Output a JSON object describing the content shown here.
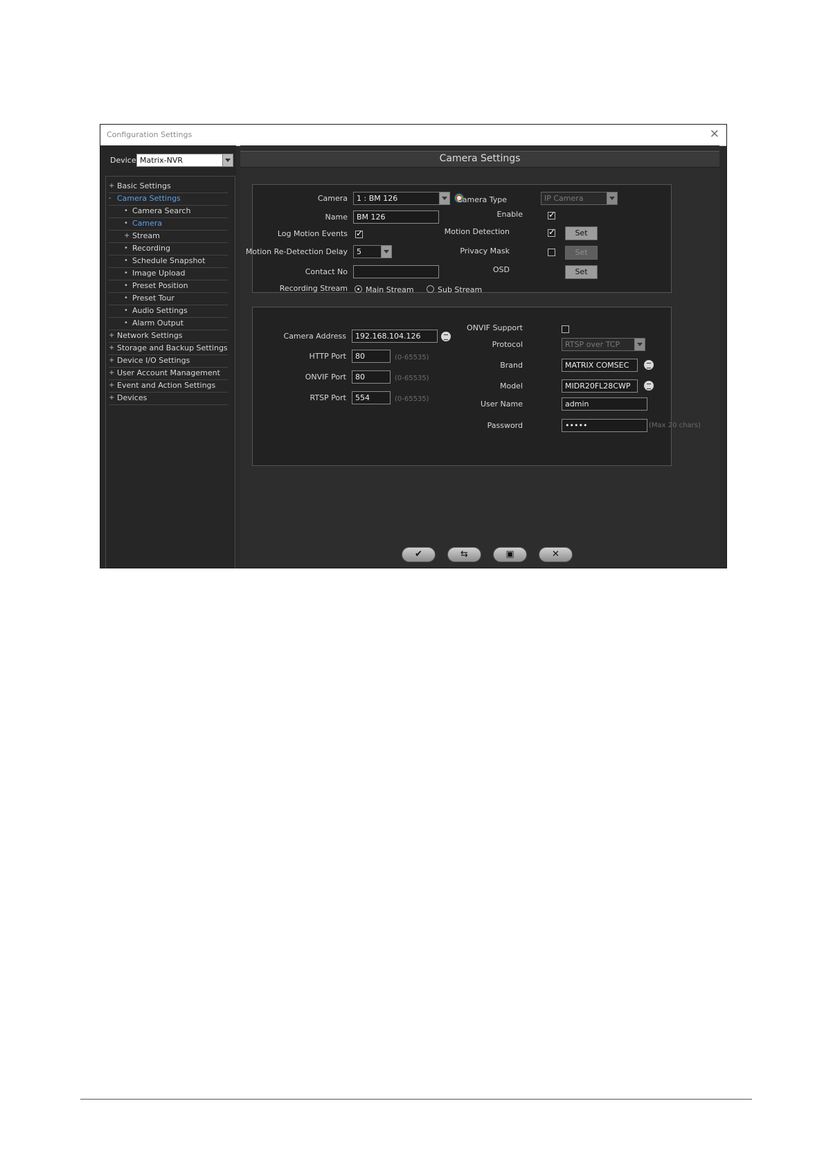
{
  "window": {
    "title": "Configuration Settings",
    "close_glyph": "✕"
  },
  "sidebar": {
    "device_label": "Device",
    "device_value": "Matrix-NVR",
    "tree": [
      {
        "prefix": "+",
        "label": "Basic Settings",
        "level": 0
      },
      {
        "prefix": "-",
        "label": "Camera Settings",
        "level": 0,
        "selected": true
      },
      {
        "prefix": "•",
        "label": "Camera Search",
        "level": 1
      },
      {
        "prefix": "•",
        "label": "Camera",
        "level": 1,
        "selected": true
      },
      {
        "prefix": "+",
        "label": "Stream",
        "level": 1
      },
      {
        "prefix": "•",
        "label": "Recording",
        "level": 1
      },
      {
        "prefix": "•",
        "label": "Schedule Snapshot",
        "level": 1
      },
      {
        "prefix": "•",
        "label": "Image Upload",
        "level": 1
      },
      {
        "prefix": "•",
        "label": "Preset Position",
        "level": 1
      },
      {
        "prefix": "•",
        "label": "Preset Tour",
        "level": 1
      },
      {
        "prefix": "•",
        "label": "Audio Settings",
        "level": 1
      },
      {
        "prefix": "•",
        "label": "Alarm Output",
        "level": 1
      },
      {
        "prefix": "+",
        "label": "Network Settings",
        "level": 0
      },
      {
        "prefix": "+",
        "label": "Storage and Backup Settings",
        "level": 0
      },
      {
        "prefix": "+",
        "label": "Device I/O Settings",
        "level": 0
      },
      {
        "prefix": "+",
        "label": "User Account Management",
        "level": 0
      },
      {
        "prefix": "+",
        "label": "Event and Action Settings",
        "level": 0
      },
      {
        "prefix": "+",
        "label": "Devices",
        "level": 0
      }
    ]
  },
  "main": {
    "header": "Camera Settings",
    "general": {
      "camera_label": "Camera",
      "camera_value": "1 : BM 126",
      "name_label": "Name",
      "name_value": "BM 126",
      "log_motion_label": "Log Motion Events",
      "log_motion_checked": true,
      "redetect_label": "Motion Re-Detection Delay",
      "redetect_value": "5",
      "contact_label": "Contact No",
      "contact_value": "",
      "recording_stream_label": "Recording Stream",
      "main_stream_label": "Main Stream",
      "sub_stream_label": "Sub Stream",
      "recording_stream_selected": "Main Stream",
      "camera_type_label": "Camera Type",
      "camera_type_value": "IP Camera",
      "enable_label": "Enable",
      "enable_checked": true,
      "motion_label": "Motion Detection",
      "motion_checked": true,
      "privacy_label": "Privacy Mask",
      "privacy_checked": false,
      "osd_label": "OSD",
      "set_label": "Set"
    },
    "network": {
      "address_label": "Camera Address",
      "address_value": "192.168.104.126",
      "http_label": "HTTP Port",
      "http_value": "80",
      "http_hint": "(0-65535)",
      "onvif_port_label": "ONVIF Port",
      "onvif_port_value": "80",
      "onvif_hint": "(0-65535)",
      "rtsp_label": "RTSP Port",
      "rtsp_value": "554",
      "rtsp_hint": "(0-65535)",
      "onvif_support_label": "ONVIF Support",
      "onvif_support_checked": false,
      "protocol_label": "Protocol",
      "protocol_value": "RTSP over TCP",
      "brand_label": "Brand",
      "brand_value": "MATRIX COMSEC",
      "model_label": "Model",
      "model_value": "MIDR20FL28CWP",
      "username_label": "User Name",
      "username_value": "admin",
      "password_label": "Password",
      "password_value": "•••••",
      "password_hint": "(Max 20 chars)"
    },
    "actions": {
      "apply_glyph": "✔",
      "refresh_glyph": "⇆",
      "save_glyph": "▣",
      "cancel_glyph": "✕"
    }
  }
}
